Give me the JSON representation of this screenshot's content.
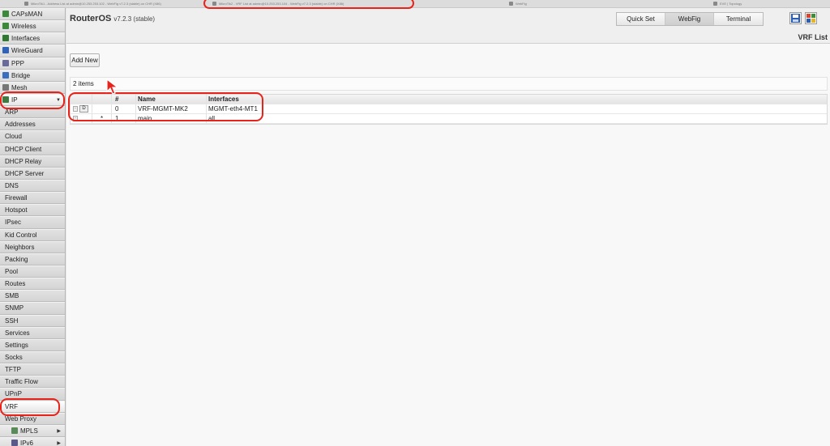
{
  "browser_tabs": [
    {
      "title": "MikroTik1 - Address List at admin@10.253.253.102 - WebFig v7.2.3 (stable) on CHR (X86)"
    },
    {
      "title": "MikroTik2 - VRF List at admin@10.253.253.104 - WebFig v7.2.3 (stable) on CHR (X86)"
    },
    {
      "title": "WebFig"
    },
    {
      "title": "EVE | Topology"
    }
  ],
  "sidebar": {
    "top_items": [
      {
        "label": "CAPsMAN",
        "icon": "capsman-icon"
      },
      {
        "label": "Wireless",
        "icon": "wireless-icon"
      },
      {
        "label": "Interfaces",
        "icon": "interfaces-icon"
      },
      {
        "label": "WireGuard",
        "icon": "wireguard-icon"
      },
      {
        "label": "PPP",
        "icon": "ppp-icon"
      },
      {
        "label": "Bridge",
        "icon": "bridge-icon"
      },
      {
        "label": "Mesh",
        "icon": "mesh-icon"
      },
      {
        "label": "IP",
        "icon": "ip-icon"
      }
    ],
    "ip_submenu": [
      "ARP",
      "Addresses",
      "Cloud",
      "DHCP Client",
      "DHCP Relay",
      "DHCP Server",
      "DNS",
      "Firewall",
      "Hotspot",
      "IPsec",
      "Kid Control",
      "Neighbors",
      "Packing",
      "Pool",
      "Routes",
      "SMB",
      "SNMP",
      "SSH",
      "Services",
      "Settings",
      "Socks",
      "TFTP",
      "Traffic Flow",
      "UPnP",
      "VRF",
      "Web Proxy"
    ],
    "bottom_items": [
      {
        "label": "MPLS",
        "icon": "mpls-icon"
      },
      {
        "label": "IPv6",
        "icon": "ipv6-icon"
      }
    ]
  },
  "header": {
    "title": "RouterOS",
    "version": "v7.2.3 (stable)",
    "buttons": [
      "Quick Set",
      "WebFig",
      "Terminal"
    ],
    "page_title": "VRF List"
  },
  "toolbar": {
    "add_new": "Add New"
  },
  "list": {
    "count_text": "2 items",
    "columns": [
      "#",
      "Name",
      "Interfaces"
    ],
    "rows": [
      {
        "flag_button": "D",
        "marker": "",
        "num": "0",
        "name": "VRF-MGMT-MK2",
        "interfaces": "MGMT-eth4-MT1"
      },
      {
        "flag_button": "",
        "marker": "*",
        "num": "1",
        "name": "main",
        "interfaces": "all"
      }
    ]
  },
  "colors": {
    "annotation": "#e8231b",
    "accent": "#2c5fb3"
  }
}
